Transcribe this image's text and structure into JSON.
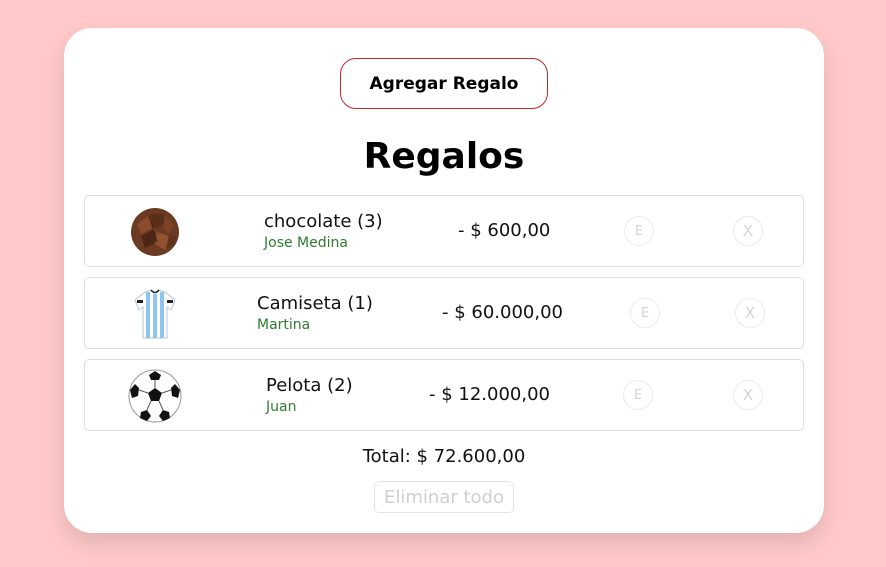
{
  "add_button_label": "Agregar Regalo",
  "title": "Regalos",
  "gifts": [
    {
      "name": "chocolate (3)",
      "recipient": "Jose Medina",
      "price": "- $ 600,00",
      "edit_label": "E",
      "delete_label": "X",
      "icon": "chocolate-image"
    },
    {
      "name": "Camiseta (1)",
      "recipient": "Martina",
      "price": "- $ 60.000,00",
      "edit_label": "E",
      "delete_label": "X",
      "icon": "jersey-image"
    },
    {
      "name": "Pelota (2)",
      "recipient": "Juan",
      "price": "- $ 12.000,00",
      "edit_label": "E",
      "delete_label": "X",
      "icon": "soccer-ball-image"
    }
  ],
  "total_label": "Total: $ 72.600,00",
  "clear_all_label": "Eliminar todo",
  "colors": {
    "background": "#ffc9c9",
    "card": "#ffffff",
    "accent_border": "#c62828",
    "recipient_text": "#2e7d32"
  }
}
